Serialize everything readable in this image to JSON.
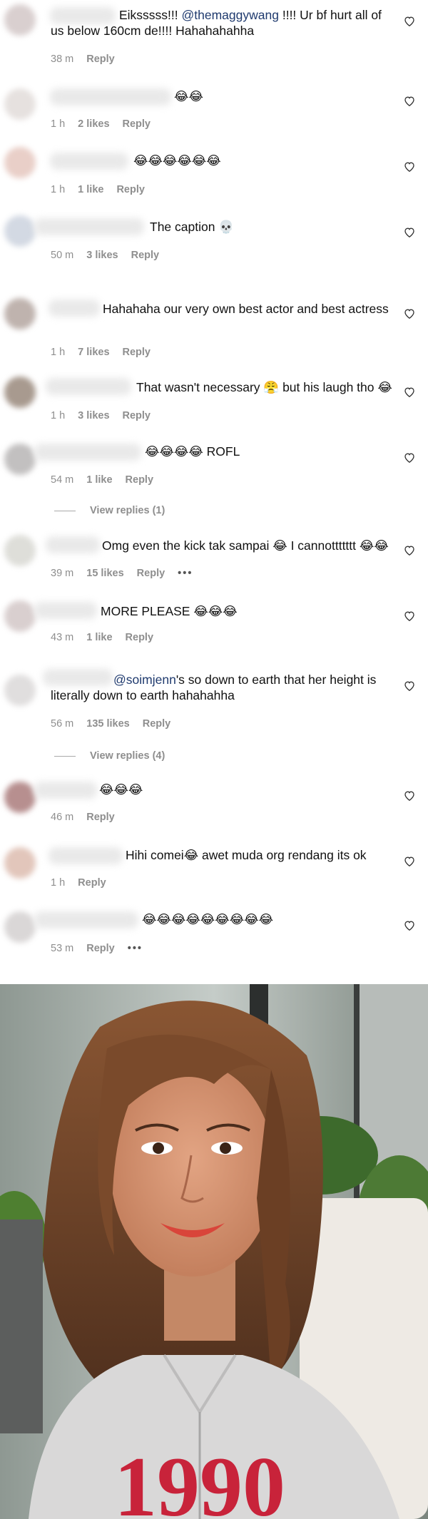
{
  "comments": [
    {
      "text_pre": "Eiksssss!!! ",
      "mention": "@themaggywang",
      "text_post": " !!!! Ur bf hurt all of us below 160cm de!!!! Hahahahahha",
      "time": "38 m",
      "likes": "",
      "reply": "Reply"
    },
    {
      "text": "😂😂",
      "time": "1 h",
      "likes": "2 likes",
      "reply": "Reply"
    },
    {
      "text": "😂😂😂😂😂😂",
      "time": "1 h",
      "likes": "1 like",
      "reply": "Reply"
    },
    {
      "text": "The caption 💀",
      "time": "50 m",
      "likes": "3 likes",
      "reply": "Reply"
    },
    {
      "text": "Hahahaha our very own best actor and best actress",
      "time": "1 h",
      "likes": "7 likes",
      "reply": "Reply"
    },
    {
      "text": "That wasn't necessary 😤 but his laugh tho 😂",
      "time": "1 h",
      "likes": "3 likes",
      "reply": "Reply"
    },
    {
      "text": "😂😂😂😂 ROFL",
      "time": "54 m",
      "likes": "1 like",
      "reply": "Reply",
      "view_replies": "View replies (1)"
    },
    {
      "text": "Omg even the kick tak sampai 😂 I cannottttttt 😂😂",
      "time": "39 m",
      "likes": "15 likes",
      "reply": "Reply",
      "more": "•••"
    },
    {
      "text": "MORE PLEASE 😂😂😂",
      "time": "43 m",
      "likes": "1 like",
      "reply": "Reply"
    },
    {
      "mention": "@soimjenn",
      "text_post": "'s so down to earth that her height is literally down to earth hahahahha",
      "time": "56 m",
      "likes": "135 likes",
      "reply": "Reply",
      "view_replies": "View replies (4)"
    },
    {
      "text": "😂😂😂",
      "time": "46 m",
      "likes": "",
      "reply": "Reply"
    },
    {
      "text": "Hihi comei😂 awet muda org rendang its ok",
      "time": "1 h",
      "likes": "",
      "reply": "Reply"
    },
    {
      "text": "😂😂😂😂😂😂😂😂😂",
      "time": "53 m",
      "likes": "",
      "reply": "Reply",
      "more": "•••"
    }
  ],
  "colors": {
    "mention": "#1f3a6e",
    "meta": "#8e8e8e"
  },
  "photo": {
    "subject": "woman-selfie",
    "sweater_print": "1990"
  }
}
